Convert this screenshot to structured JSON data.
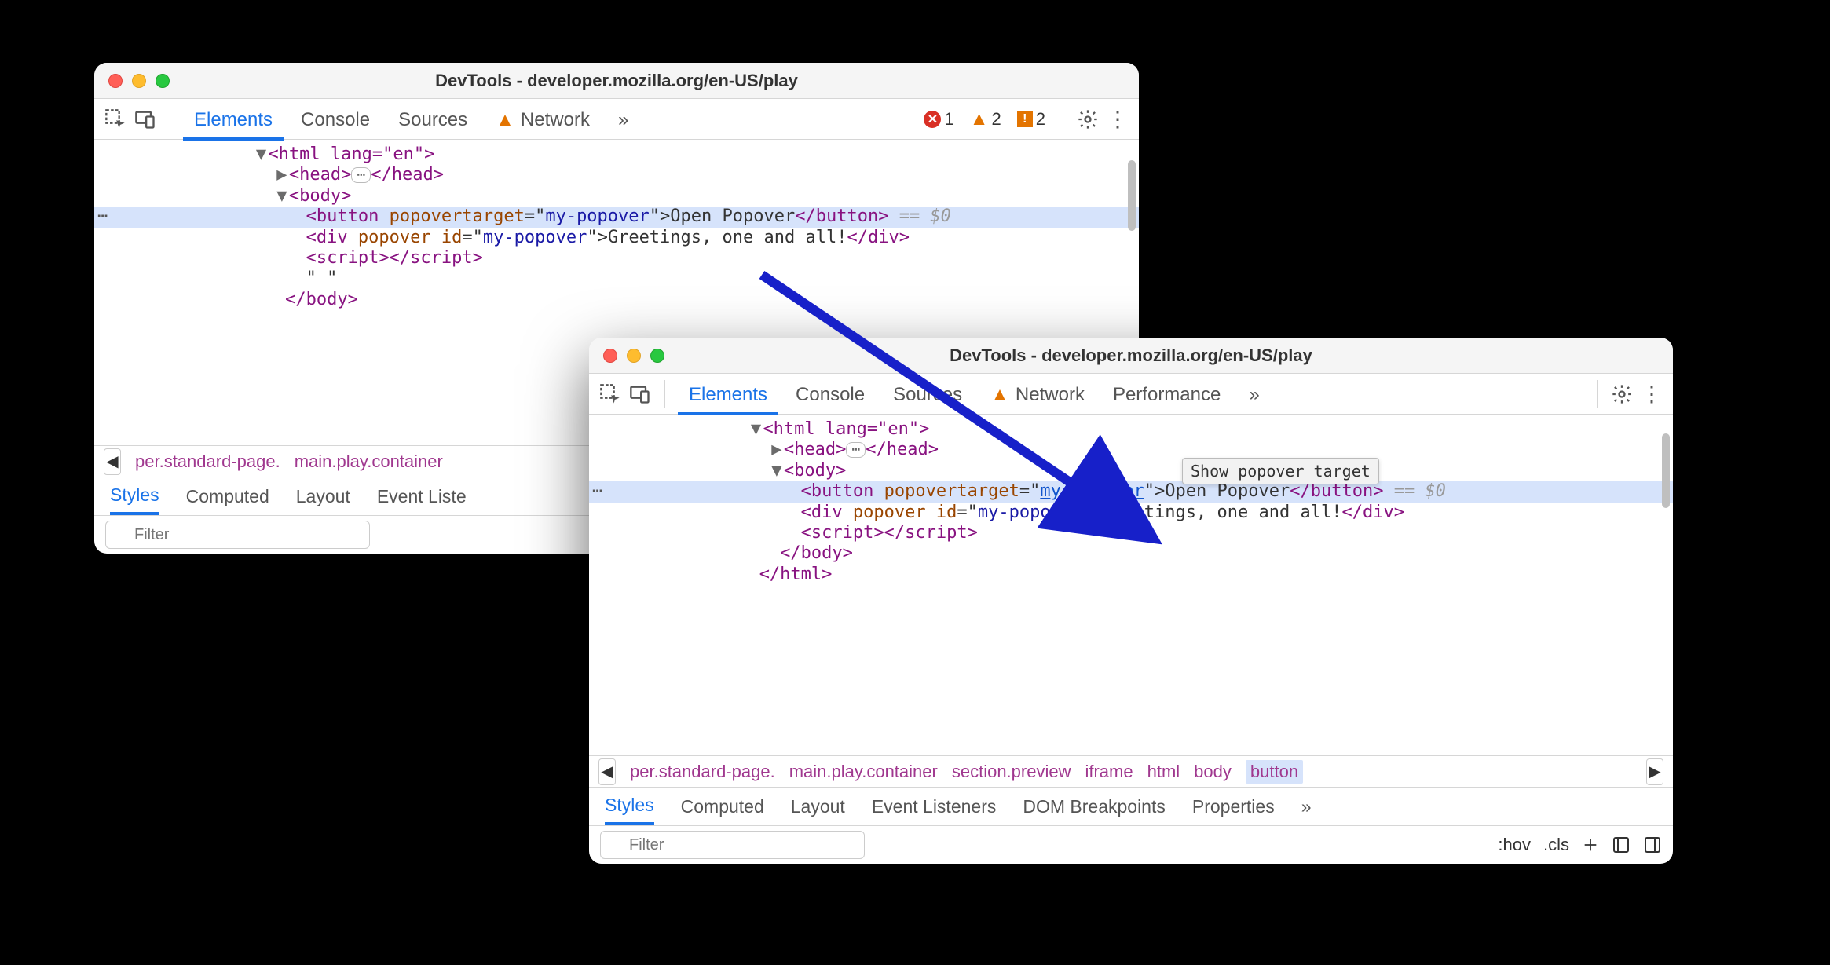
{
  "window1": {
    "title": "DevTools - developer.mozilla.org/en-US/play",
    "tabs": [
      "Elements",
      "Console",
      "Sources",
      "Network"
    ],
    "active_tab": 0,
    "overflow": "»",
    "issue_error": "1",
    "issue_warn": "2",
    "issue_info": "2",
    "dom": {
      "html_open": "<html lang=\"en\">",
      "head": {
        "open": "<head>",
        "close": "</head>"
      },
      "body_open": "<body>",
      "button": {
        "open": "<button ",
        "attr": "popovertarget",
        "val": "my-popover",
        "text": "Open Popover",
        "close": "</button>",
        "eq0": " == $0"
      },
      "div": {
        "open": "<div ",
        "attr1": "popover",
        "attr2": "id",
        "val2": "my-popover",
        "text": "Greetings, one and all!",
        "close": "</div>"
      },
      "script": {
        "open": "<script>",
        "close": "</script>"
      },
      "quote": "\" \"",
      "body_close": "</body>"
    },
    "crumbs": [
      "per.standard-page.",
      "main.play.container"
    ],
    "subtabs": [
      "Styles",
      "Computed",
      "Layout",
      "Event Liste"
    ],
    "active_subtab": 0,
    "filter_placeholder": "Filter"
  },
  "window2": {
    "title": "DevTools - developer.mozilla.org/en-US/play",
    "tabs": [
      "Elements",
      "Console",
      "Sources",
      "Network",
      "Performance"
    ],
    "active_tab": 0,
    "overflow": "»",
    "dom": {
      "html_open": "<html lang=\"en\">",
      "head": {
        "open": "<head>",
        "close": "</head>"
      },
      "body_open": "<body>",
      "button": {
        "open": "<button ",
        "attr": "popovertarget",
        "val": "my-popover",
        "text": "Open Popover",
        "close": "</button>",
        "eq0": " == $0"
      },
      "div": {
        "open": "<div ",
        "attr1": "popover",
        "attr2": "id",
        "val2": "my-popover",
        "text": "Greetings, one and all!",
        "close": "</div>"
      },
      "script": {
        "open": "<script>",
        "close": "</script>"
      },
      "body_close": "</body>",
      "html_close": "</html>"
    },
    "tooltip": "Show popover target",
    "crumbs": [
      "per.standard-page.",
      "main.play.container",
      "section.preview",
      "iframe",
      "html",
      "body",
      "button"
    ],
    "selected_crumb_index": 6,
    "subtabs": [
      "Styles",
      "Computed",
      "Layout",
      "Event Listeners",
      "DOM Breakpoints",
      "Properties"
    ],
    "active_subtab": 0,
    "filter_placeholder": "Filter",
    "tool_hov": ":hov",
    "tool_cls": ".cls"
  }
}
